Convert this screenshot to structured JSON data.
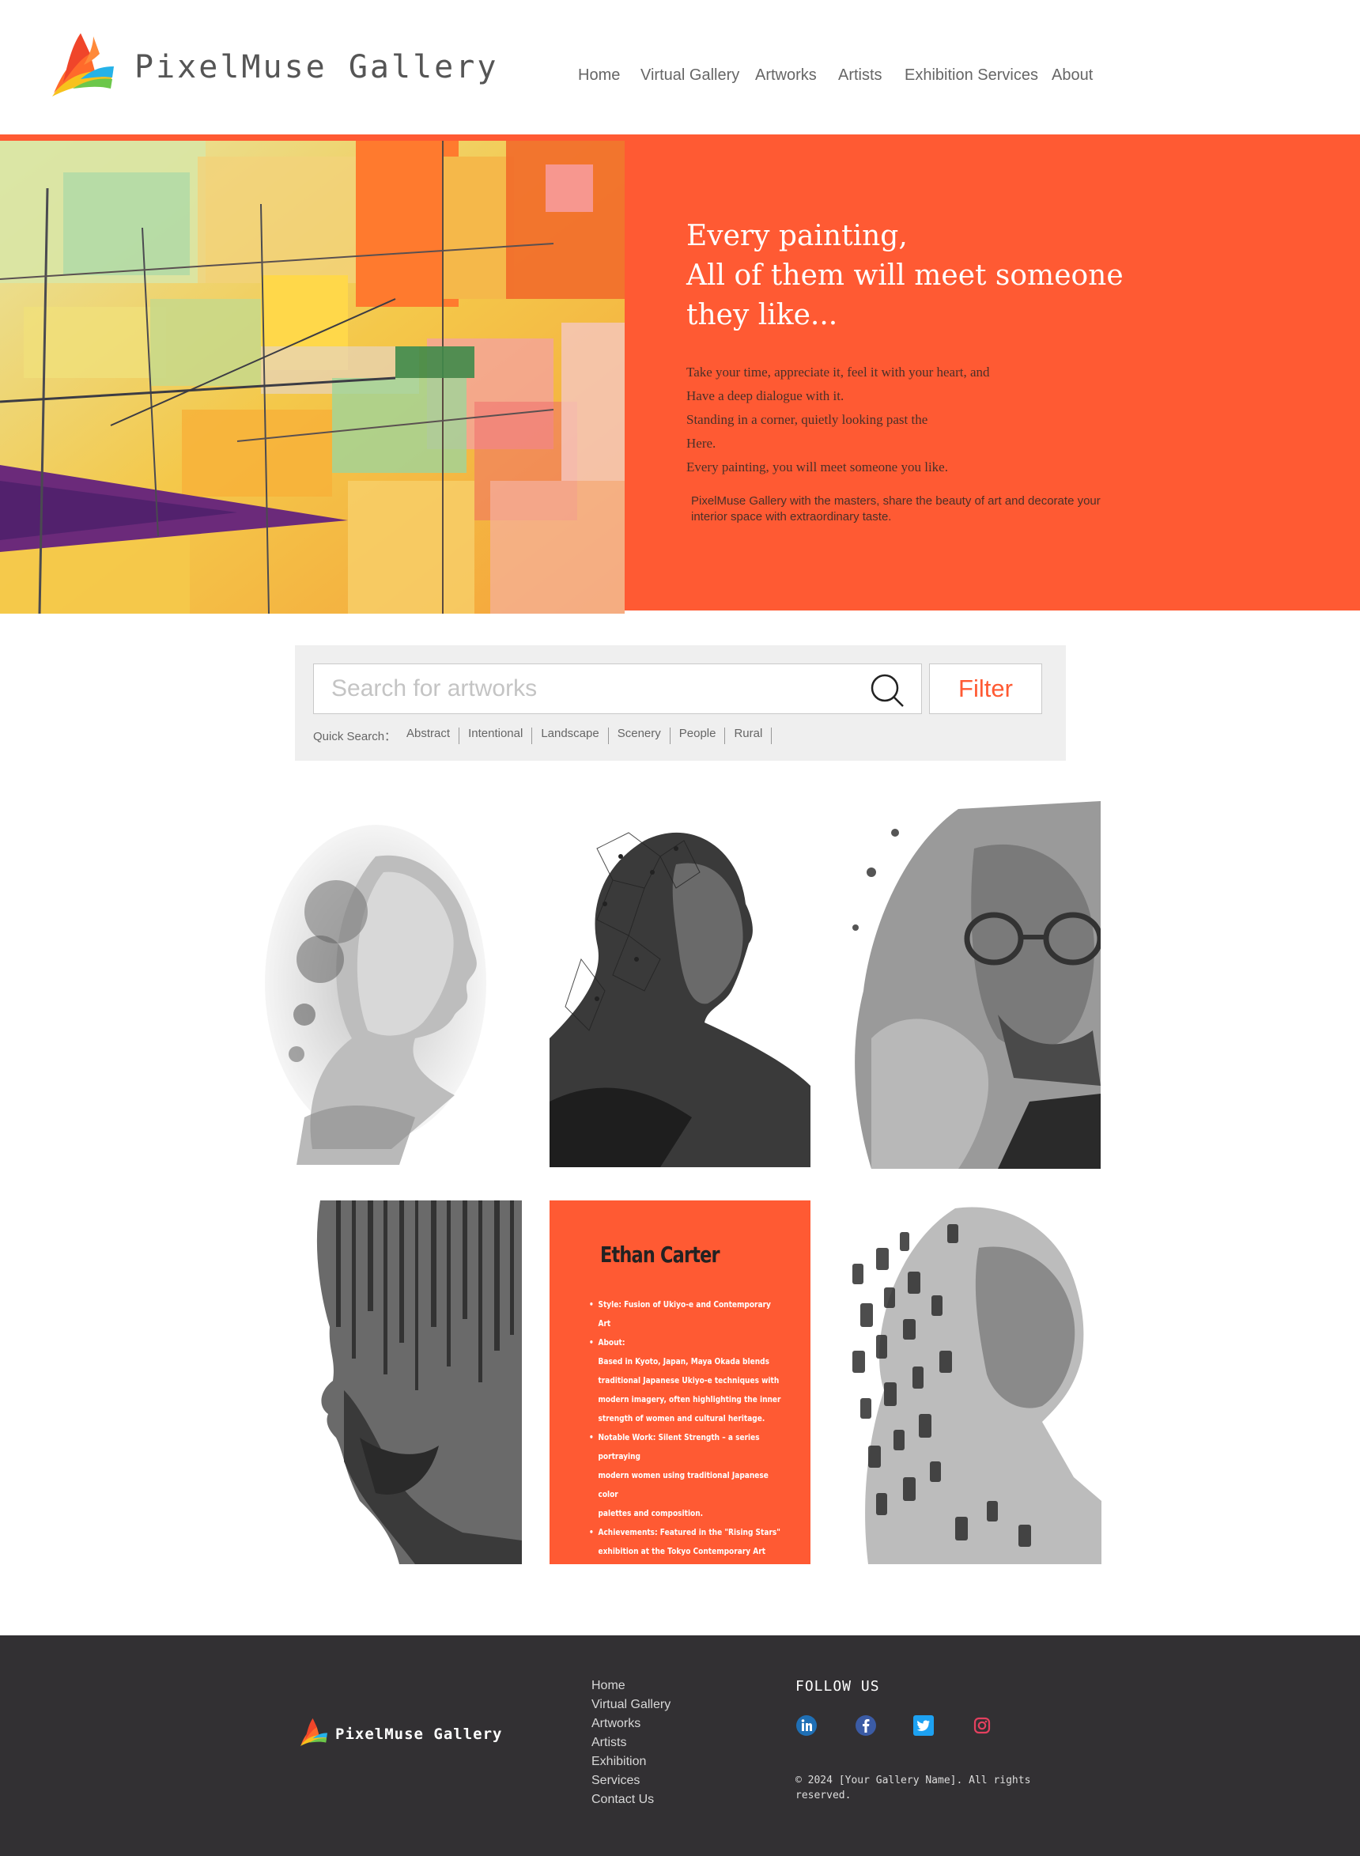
{
  "brand": {
    "name": "PixelMuse Gallery"
  },
  "nav": {
    "items": [
      "Home",
      "Virtual Gallery",
      "Artworks",
      "Artists",
      "Exhibition Services",
      "About"
    ]
  },
  "hero": {
    "title_lines": [
      "Every painting,",
      "All of them will meet someone",
      "they like..."
    ],
    "body_lines": [
      "Take your time, appreciate it, feel it with your heart, and",
      "Have a deep dialogue with it.",
      "Standing in a corner, quietly looking past the",
      "Here.",
      "Every painting, you will meet someone you like."
    ],
    "subtext": "PixelMuse Gallery with the masters, share the beauty of art and decorate your interior space with extraordinary taste."
  },
  "search": {
    "placeholder": "Search for artworks",
    "filter_label": "Filter",
    "quick_label": "Quick Search：",
    "quick_tags": [
      "Abstract",
      "Intentional",
      "Landscape",
      "Scenery",
      "People",
      "Rural"
    ]
  },
  "artist": {
    "name": "Ethan Carter",
    "style": "Style: Fusion of Ukiyo-e and Contemporary Art",
    "about_label": "About:",
    "about_lines": [
      "Based in Kyoto, Japan, Maya Okada blends",
      "traditional Japanese Ukiyo-e techniques with",
      "modern imagery, often highlighting the inner",
      "strength of women and cultural heritage."
    ],
    "notable_lines": [
      "Notable Work: Silent Strength – a series portraying",
      "modern women using traditional Japanese color",
      "palettes and composition."
    ],
    "achievement_lines": [
      "Achievements: Featured in the \"Rising Stars\"",
      "exhibition at the Tokyo Contemporary Art Fair."
    ]
  },
  "footer": {
    "links": [
      "Home",
      "Virtual Gallery",
      "Artworks",
      "Artists",
      "Exhibition",
      "Services",
      "Contact Us"
    ],
    "follow_label": "FOLLOW US",
    "social_icons": [
      "linkedin-icon",
      "facebook-icon",
      "twitter-icon",
      "instagram-icon"
    ],
    "copyright_lines": [
      "© 2024 [Your Gallery Name]. All rights",
      "reserved."
    ]
  },
  "colors": {
    "accent": "#ff5a33",
    "footer_bg": "#323033",
    "search_bg": "#efefef"
  }
}
